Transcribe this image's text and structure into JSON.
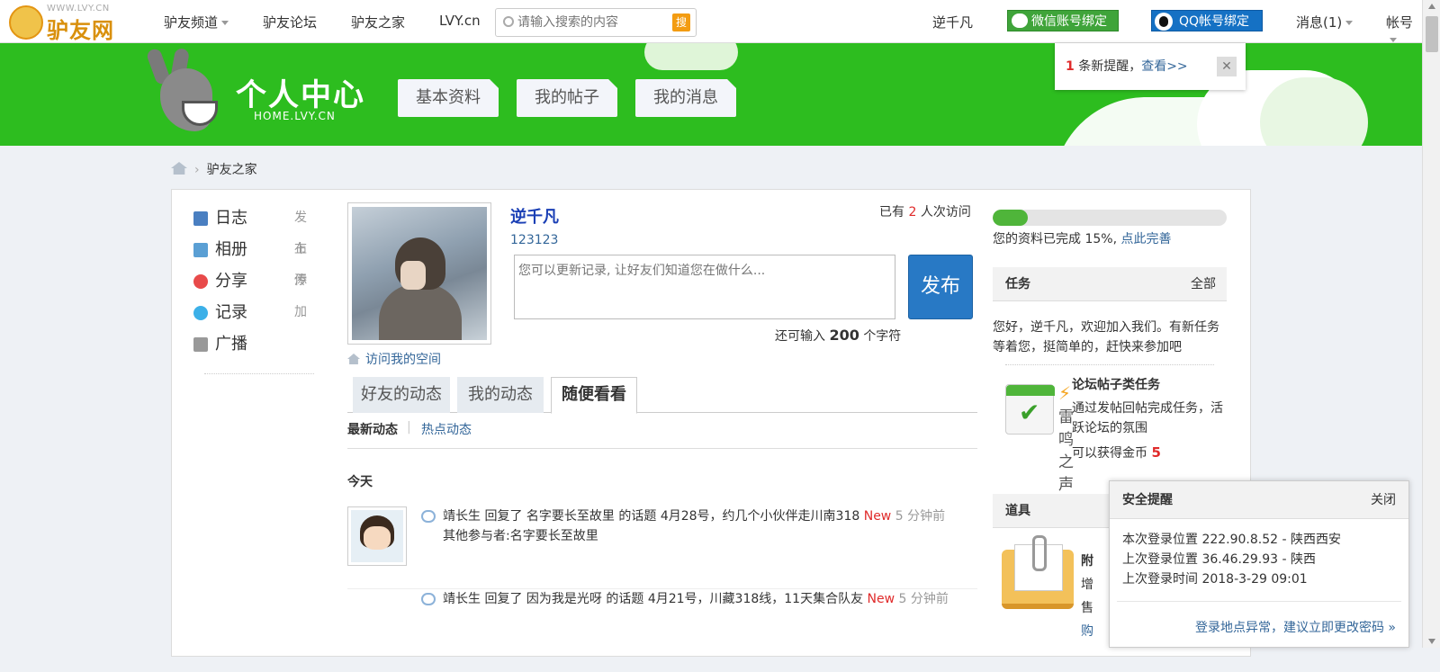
{
  "topbar": {
    "logo_site": "WWW.LVY.CN",
    "logo_name": "驴友网",
    "nav": [
      {
        "label": "驴友频道",
        "dropdown": true
      },
      {
        "label": "驴友论坛"
      },
      {
        "label": "驴友之家"
      },
      {
        "label": "LVY.cn"
      }
    ],
    "search_placeholder": "请输入搜索的内容",
    "search_button": "搜",
    "username": "逆千凡",
    "wechat_bind": "微信账号绑定",
    "qq_bind": "QQ帐号绑定",
    "messages": "消息(1)",
    "account": "帐号"
  },
  "banner": {
    "title": "个人中心",
    "subtitle": "HOME.LVY.CN",
    "tabs": [
      "基本资料",
      "我的帖子",
      "我的消息"
    ]
  },
  "notification": {
    "count": "1",
    "text": "条新提醒，",
    "link": "查看>>",
    "close": "✕"
  },
  "breadcrumb": {
    "current": "驴友之家"
  },
  "left_menu": [
    {
      "label": "日志",
      "action": "发布",
      "icon": "blog-icon",
      "color": "#4a7fc1"
    },
    {
      "label": "相册",
      "action": "上传",
      "icon": "album-icon",
      "color": "#5a9fd4"
    },
    {
      "label": "分享",
      "action": "添加",
      "icon": "share-icon",
      "color": "#e84a4a"
    },
    {
      "label": "记录",
      "action": "",
      "icon": "record-icon",
      "color": "#3cb0e8"
    },
    {
      "label": "广播",
      "action": "",
      "icon": "broadcast-icon",
      "color": "#999999"
    }
  ],
  "profile": {
    "name": "逆千凡",
    "uid": "123123",
    "visits_pre": "已有",
    "visits_count": "2",
    "visits_post": "人次访问",
    "visit_space": "访问我的空间",
    "status_placeholder": "您可以更新记录, 让好友们知道您在做什么...",
    "post_button": "发布",
    "remain_pre": "还可输入",
    "remain_count": "200",
    "remain_post": "个字符"
  },
  "feed_tabs": {
    "tabs": [
      "好友的动态",
      "我的动态",
      "随便看看"
    ],
    "active": "随便看看",
    "thunder": "雷鸣之声",
    "sub_latest": "最新动态",
    "sub_sep": "|",
    "sub_hot": "热点动态",
    "today": "今天"
  },
  "feed": [
    {
      "user": "靖长生",
      "verb": "回复了",
      "target_user": "名字要长至故里",
      "mid": "的话题",
      "topic": "4月28号，约几个小伙伴走川南318",
      "new": "New",
      "time": "5 分钟前",
      "others": "其他参与者:名字要长至故里"
    },
    {
      "user": "靖长生",
      "verb": "回复了",
      "target_user": "因为我是光呀",
      "mid": "的话题",
      "topic": "4月21号，川藏318线，11天集合队友",
      "new": "New",
      "time": "5 分钟前",
      "others": ""
    }
  ],
  "right": {
    "progress_percent": 15,
    "progress_text": "您的资料已完成 15%,",
    "progress_link": "点此完善",
    "task_header": "任务",
    "task_more": "全部",
    "task_intro": "您好，逆千凡，欢迎加入我们。有新任务等着您，挺简单的，赶快来参加吧",
    "task_title": "论坛帖子类任务",
    "task_desc": "通过发帖回帖完成任务，活跃论坛的氛围",
    "task_gold_pre": "可以获得金币",
    "task_gold": "5",
    "prop_header": "道具",
    "prop_frag": [
      "附",
      "增",
      "售",
      "购"
    ]
  },
  "security": {
    "title": "安全提醒",
    "close": "关闭",
    "line1": "本次登录位置 222.90.8.52 - 陕西西安",
    "line2": "上次登录位置 36.46.29.93 - 陕西",
    "line3": "上次登录时间 2018-3-29 09:01",
    "warning": "登录地点异常，建议立即更改密码 »"
  },
  "colors": {
    "banner_green": "#2dbd1f",
    "link_blue": "#336699",
    "alert_red": "#e02b2b",
    "post_blue": "#2879c5"
  }
}
